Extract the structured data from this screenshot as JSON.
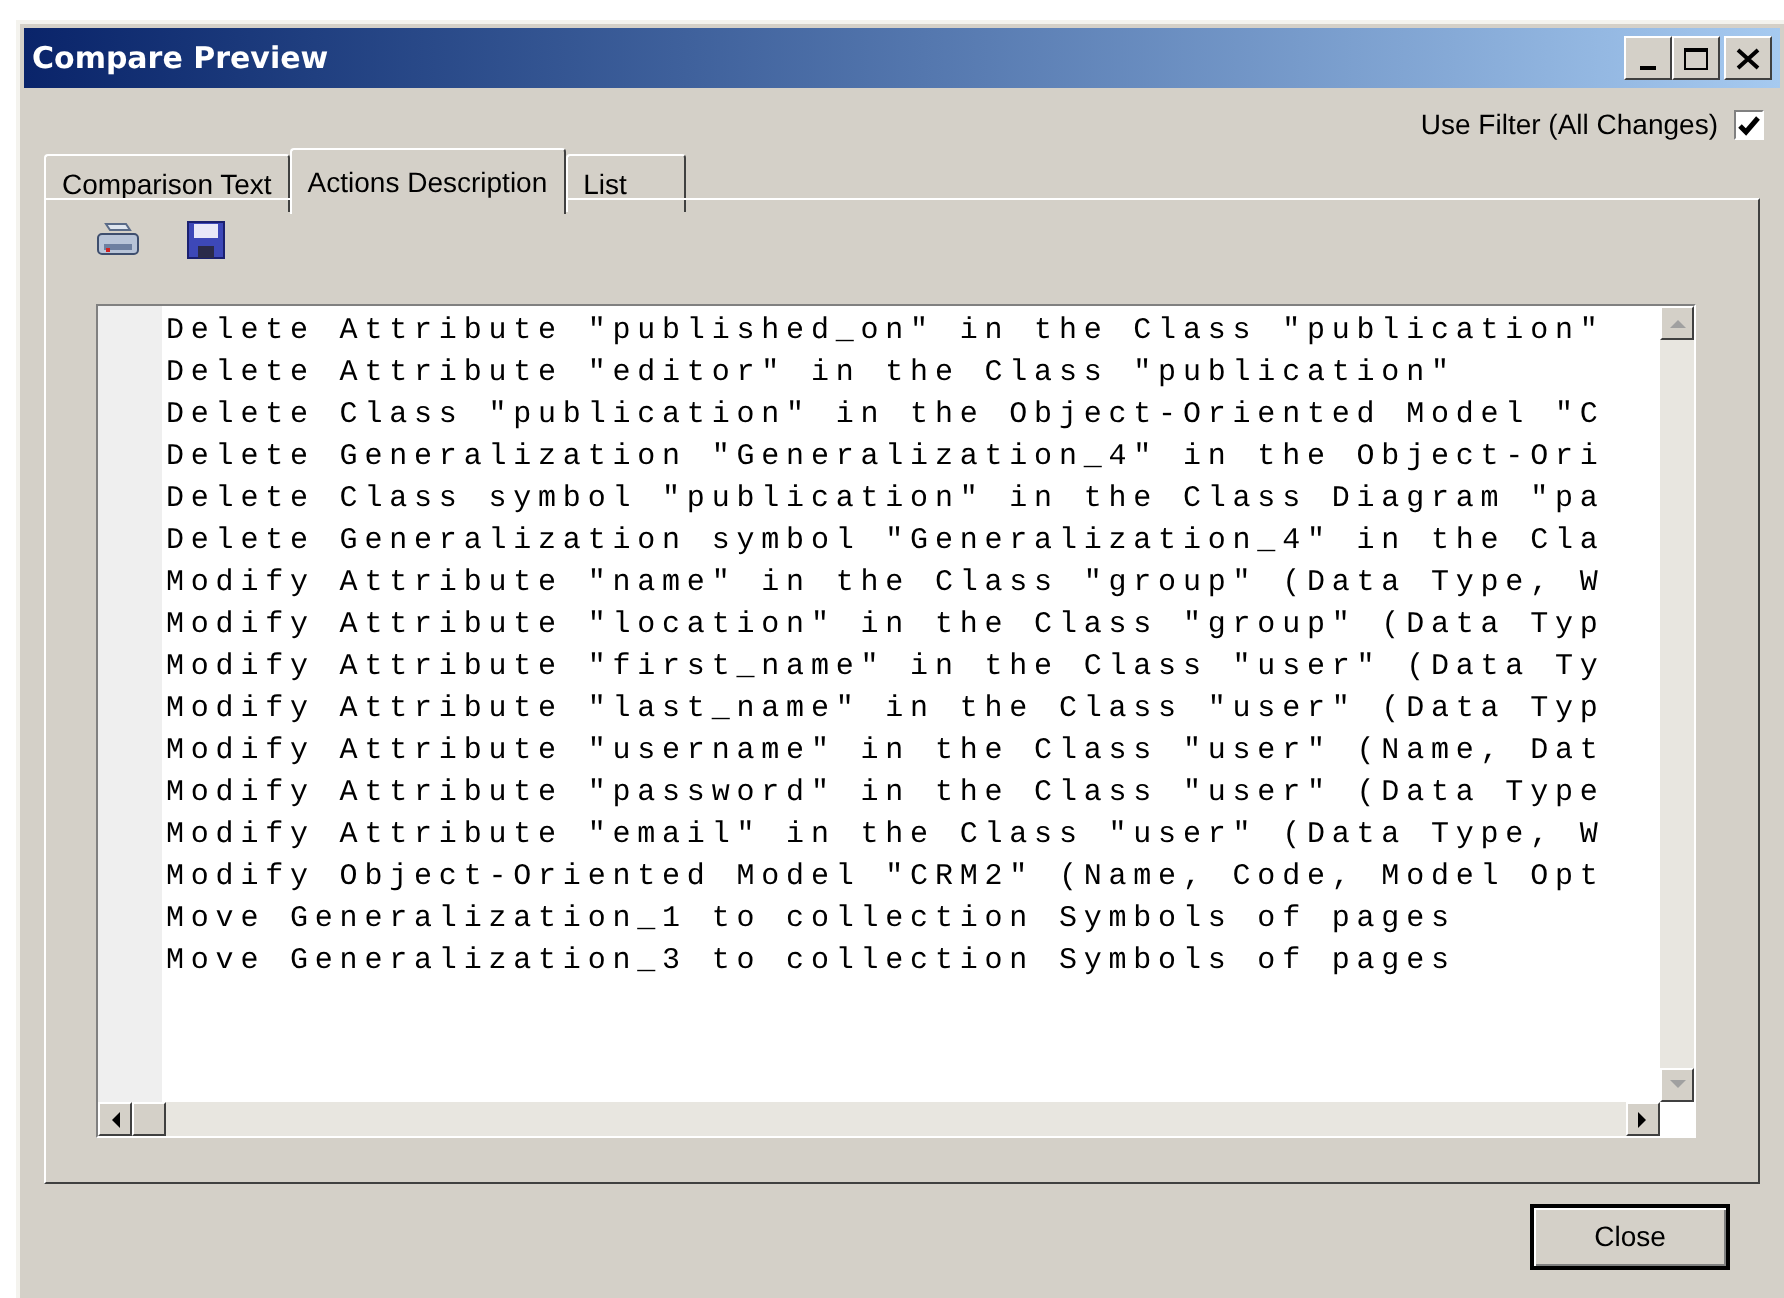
{
  "window": {
    "title": "Compare Preview"
  },
  "tabs": [
    {
      "label": "Comparison Text",
      "selected": false
    },
    {
      "label": "Actions Description",
      "selected": true
    },
    {
      "label": "List",
      "selected": false
    }
  ],
  "filter": {
    "label": "Use Filter (All Changes)",
    "checked": true
  },
  "lines": [
    "Delete Attribute \"published_on\" in the Class \"publication\"",
    "Delete Attribute \"editor\" in the Class \"publication\"",
    "Delete Class \"publication\" in the Object-Oriented Model \"C",
    "Delete Generalization \"Generalization_4\" in the Object-Ori",
    "Delete Class symbol \"publication\" in the Class Diagram \"pa",
    "Delete Generalization symbol \"Generalization_4\" in the Cla",
    "Modify Attribute \"name\" in the Class \"group\" (Data Type, W",
    "Modify Attribute \"location\" in the Class \"group\" (Data Typ",
    "Modify Attribute \"first_name\" in the Class \"user\" (Data Ty",
    "Modify Attribute \"last_name\" in the Class \"user\" (Data Typ",
    "Modify Attribute \"username\" in the Class \"user\" (Name, Dat",
    "Modify Attribute \"password\" in the Class \"user\" (Data Type",
    "Modify Attribute \"email\" in the Class \"user\" (Data Type, W",
    "Modify Object-Oriented Model \"CRM2\" (Name, Code, Model Opt",
    "Move Generalization_1 to collection Symbols of pages",
    "Move Generalization_3 to collection Symbols of pages"
  ],
  "close_button": "Close"
}
